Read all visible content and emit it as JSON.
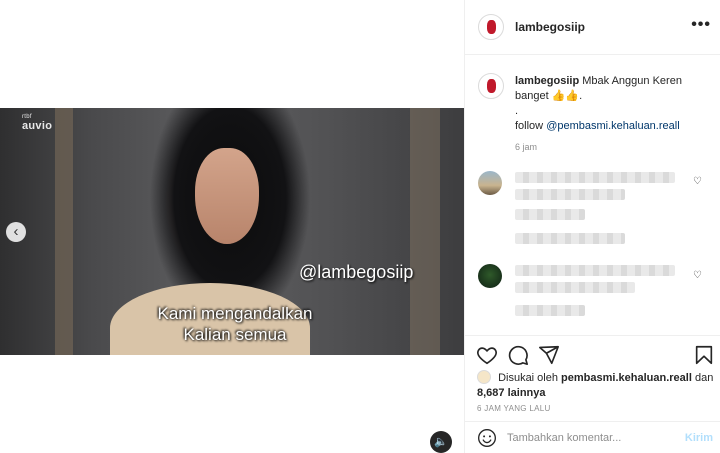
{
  "post": {
    "username": "lambegosiip",
    "more_icon": "more-horizontal-icon"
  },
  "video": {
    "channel_logo": "auvio",
    "channel_logo_small": "rtbf",
    "watermark": "@lambegosiip",
    "subtitle_line1": "Kami mengandalkan",
    "subtitle_line2": "Kalian semua",
    "prev_glyph": "‹",
    "sound_glyph": "🔈"
  },
  "caption": {
    "username": "lambegosiip",
    "text": "Mbak Anggun Keren banget 👍👍.",
    "dot": ".",
    "follow_label": "follow",
    "mention": "@pembasmi.kehaluan.reall",
    "time": "6 jam"
  },
  "likes": {
    "prefix": "Disukai oleh",
    "liker": "pembasmi.kehaluan.reall",
    "and": "dan",
    "count": "8,687 lainnya"
  },
  "timestamp": "6 JAM YANG LALU",
  "comment_box": {
    "placeholder": "Tambahkan komentar...",
    "post_label": "Kirim"
  },
  "colors": {
    "link": "#00376b",
    "muted": "#8e8e8e",
    "post_button_disabled": "#b2dffc"
  }
}
